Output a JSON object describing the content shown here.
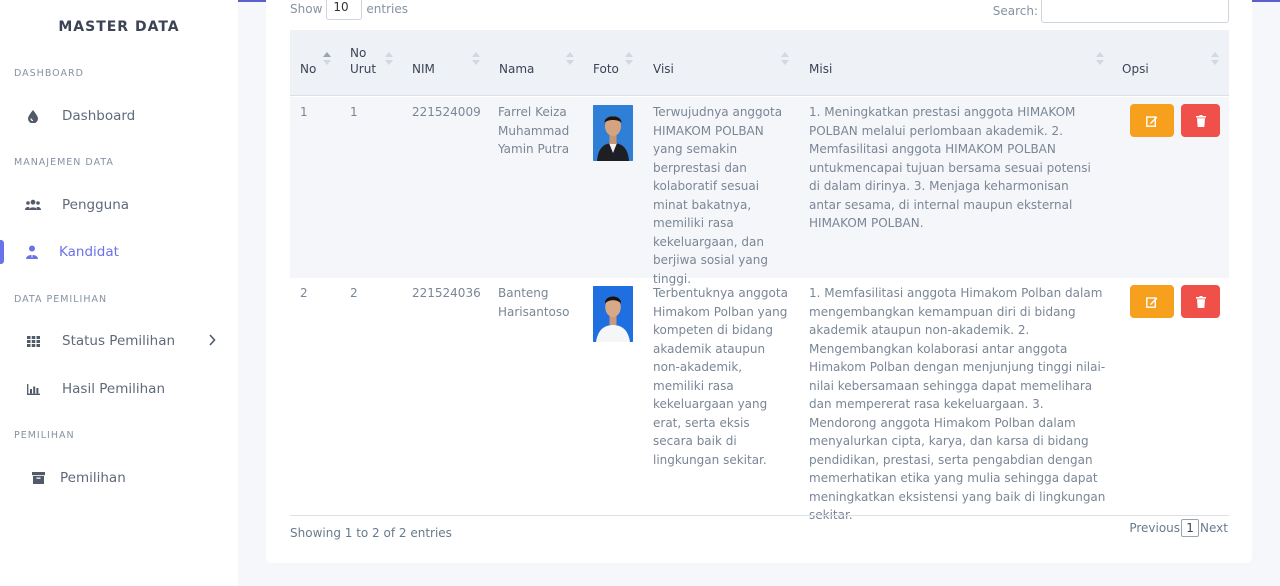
{
  "sidebar": {
    "brand": "MASTER DATA",
    "sections": {
      "dashboard": "DASHBOARD",
      "manajemen": "MANAJEMEN DATA",
      "data_pemilihan": "DATA PEMILIHAN",
      "pemilihan": "PEMILIHAN"
    },
    "items": {
      "dashboard": "Dashboard",
      "pengguna": "Pengguna",
      "kandidat": "Kandidat",
      "status_pemilihan": "Status Pemilihan",
      "hasil_pemilihan": "Hasil Pemilihan",
      "pemilihan": "Pemilihan"
    },
    "active": "Kandidat",
    "accent": "#6a72e8"
  },
  "table_controls": {
    "show_label": "Show",
    "entries_value": "10",
    "entries_label": "entries",
    "search_label": "Search:",
    "search_value": ""
  },
  "table": {
    "headers": [
      "No",
      "No Urut",
      "NIM",
      "Nama",
      "Foto",
      "Visi",
      "Misi",
      "Opsi"
    ],
    "rows": [
      {
        "no": "1",
        "no_urut": "1",
        "nim": "221524009",
        "nama": "Farrel Keiza Muhammad Yamin Putra",
        "visi": "Terwujudnya anggota HIMAKOM POLBAN yang semakin berprestasi dan kolaboratif sesuai minat bakatnya, memiliki rasa kekeluargaan, dan berjiwa sosial yang tinggi.",
        "misi": "1. Meningkatkan prestasi anggota HIMAKOM POLBAN melalui perlombaan akademik. 2. Memfasilitasi anggota HIMAKOM POLBAN untukmencapai tujuan bersama sesuai potensi di dalam dirinya. 3. Menjaga keharmonisan antar sesama, di internal maupun eksternal HIMAKOM POLBAN."
      },
      {
        "no": "2",
        "no_urut": "2",
        "nim": "221524036",
        "nama": "Banteng Harisantoso",
        "visi": "Terbentuknya anggota Himakom Polban yang kompeten di bidang akademik ataupun non-akademik, memiliki rasa kekeluargaan yang erat, serta eksis secara baik di lingkungan sekitar.",
        "misi": "1. Memfasilitasi anggota Himakom Polban dalam mengembangkan kemampuan diri di bidang akademik ataupun non-akademik. 2. Mengembangkan kolaborasi antar anggota Himakom Polban dengan menjunjung tinggi nilai-nilai kebersamaan sehingga dapat memelihara dan mempererat rasa kekeluargaan. 3. Mendorong anggota Himakom Polban dalam menyalurkan cipta, karya, dan karsa di bidang pendidikan, prestasi, serta pengabdian dengan memerhatikan etika yang mulia sehingga dapat meningkatkan eksistensi yang baik di lingkungan sekitar."
      }
    ],
    "edit_color": "#f6a01e",
    "delete_color": "#f0504a"
  },
  "footer": {
    "info": "Showing 1 to 2 of 2 entries",
    "previous": "Previous",
    "page": "1",
    "next": "Next"
  }
}
